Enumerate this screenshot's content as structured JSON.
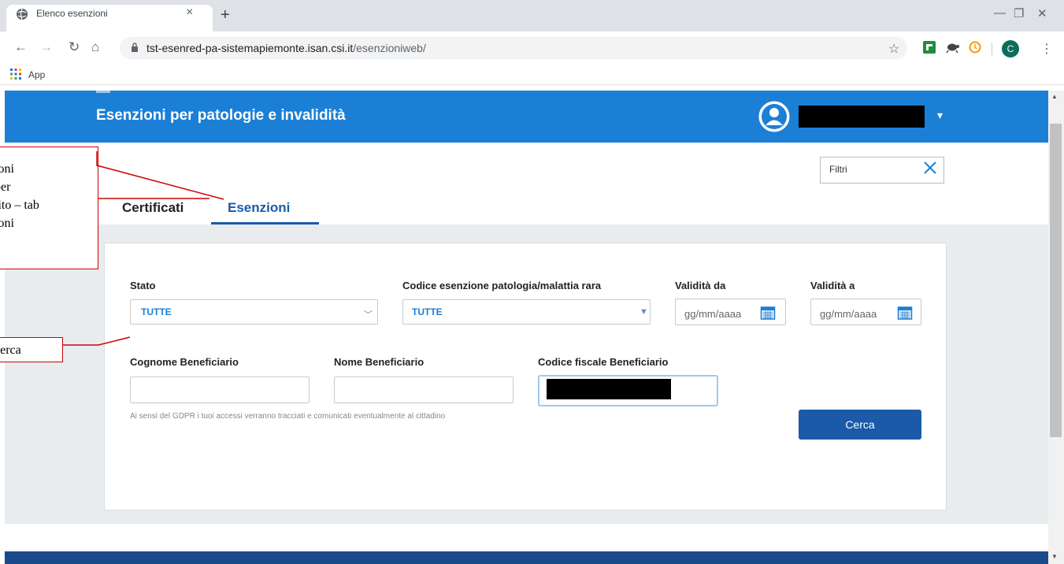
{
  "browser": {
    "tab_title": "Elenco esenzioni",
    "tab_close": "×",
    "new_tab": "+",
    "url_host": "tst-esenred-pa-sistemapiemonte.isan.csi.it",
    "url_path": "/esenzioniweb/",
    "bookmark_apps": "App",
    "profile_initial": "C",
    "window_minimize": "—",
    "window_maximize": "❐",
    "window_close": "✕"
  },
  "header": {
    "title": "Esenzioni per patologie e invalidità",
    "user_caret": "▾"
  },
  "filtri": {
    "label": "Filtri"
  },
  "tabs": [
    {
      "label": "Certificati",
      "active": false
    },
    {
      "label": "Esenzioni",
      "active": true
    }
  ],
  "form": {
    "stato": {
      "label": "Stato",
      "value": "TUTTE"
    },
    "codice": {
      "label": "Codice esenzione patologia/malattia rara",
      "value": "TUTTE"
    },
    "validita_da": {
      "label": "Validità da",
      "placeholder": "gg/mm/aaaa"
    },
    "validita_a": {
      "label": "Validità a",
      "placeholder": "gg/mm/aaaa"
    },
    "cognome": {
      "label": "Cognome Beneficiario",
      "value": ""
    },
    "nome": {
      "label": "Nome Beneficiario",
      "value": ""
    },
    "codice_fiscale": {
      "label": "Codice fiscale Beneficiario"
    },
    "gdpr_note": "Ai sensi del GDPR i tuoi accessi verranno tracciati e comunicati eventualmente al cittadino",
    "search_button": "Cerca"
  },
  "callouts": {
    "tab_note_lines": [
      "ioni",
      " per",
      "tito – tab",
      "ioni"
    ],
    "search_note": "cerca"
  },
  "colors": {
    "header_blue": "#1c7fd6",
    "accent_blue": "#1a5aa8",
    "callout_red": "#cc0000"
  }
}
